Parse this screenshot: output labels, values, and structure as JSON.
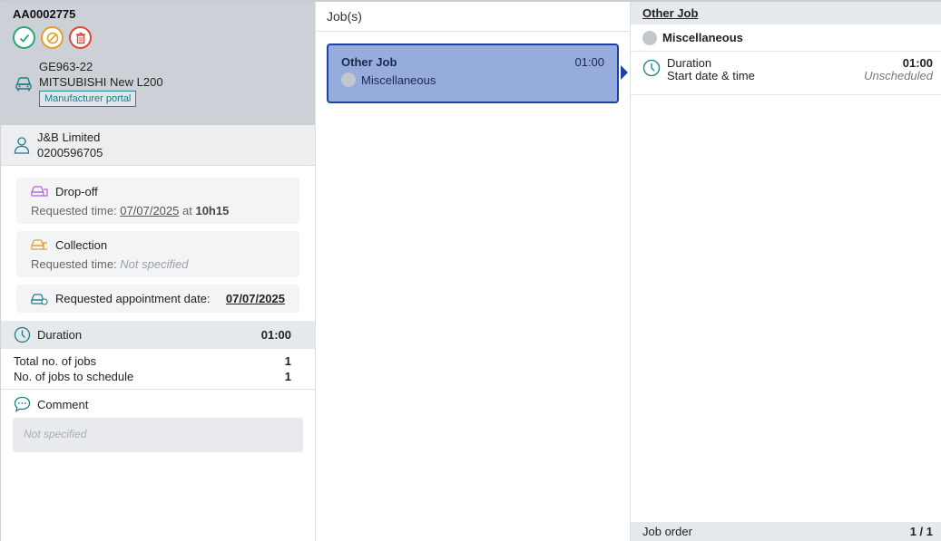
{
  "order": {
    "number": "AA0002775",
    "actions": [
      {
        "name": "validate",
        "icon": "check-circle-icon",
        "color": "#2aa876"
      },
      {
        "name": "cancel",
        "icon": "ban-icon",
        "color": "#e0a030"
      },
      {
        "name": "delete",
        "icon": "trash-icon",
        "color": "#d64a3a"
      }
    ]
  },
  "vehicle": {
    "plate": "GE963-22",
    "model": "MITSUBISHI New L200",
    "portal_label": "Manufacturer portal",
    "icon": "car-icon"
  },
  "customer": {
    "name": "J&B Limited",
    "phone": "0200596705",
    "icon": "person-icon"
  },
  "dropoff": {
    "title": "Drop-off",
    "label": "Requested time:",
    "date": "07/07/2025",
    "at": "at",
    "time": "10h15",
    "icon": "car-dropoff-icon"
  },
  "collection": {
    "title": "Collection",
    "label": "Requested time:",
    "value": "Not specified",
    "icon": "car-collection-icon"
  },
  "appointment": {
    "label": "Requested appointment date:",
    "date": "07/07/2025",
    "icon": "car-calendar-icon"
  },
  "duration": {
    "label": "Duration",
    "value": "01:00",
    "icon": "clock-icon"
  },
  "counts": {
    "total_label": "Total no. of jobs",
    "total_value": "1",
    "schedule_label": "No. of jobs to schedule",
    "schedule_value": "1"
  },
  "comment": {
    "label": "Comment",
    "placeholder": "Not specified",
    "icon": "chat-icon"
  },
  "jobs": {
    "header": "Job(s)",
    "items": [
      {
        "name": "Other Job",
        "duration": "01:00",
        "category": "Miscellaneous"
      }
    ]
  },
  "detail": {
    "title": "Other Job",
    "category": "Miscellaneous",
    "duration_label": "Duration",
    "duration_value": "01:00",
    "start_label": "Start date & time",
    "start_value": "Unscheduled",
    "footer_label": "Job order",
    "footer_value": "1 / 1"
  },
  "colors": {
    "accent": "#1e40a8",
    "job_card": "#95acdc",
    "portal": "#1c8a95"
  }
}
